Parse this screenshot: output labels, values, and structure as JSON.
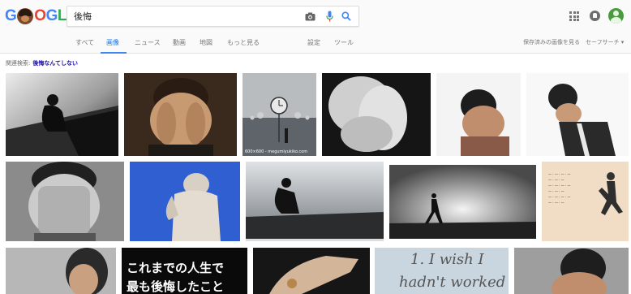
{
  "logo": {
    "letters": [
      "G",
      "O",
      "G",
      "L",
      "E"
    ],
    "colors": [
      "#4285f4",
      "#ea4335",
      "#4285f4",
      "#34a853",
      "#ea4335"
    ]
  },
  "search": {
    "value": "後悔",
    "placeholder": ""
  },
  "tabs": [
    {
      "label": "すべて",
      "active": false
    },
    {
      "label": "画像",
      "active": true
    },
    {
      "label": "ニュース",
      "active": false
    },
    {
      "label": "動画",
      "active": false
    },
    {
      "label": "地図",
      "active": false
    },
    {
      "label": "もっと見る",
      "active": false
    },
    {
      "label": "設定",
      "active": false
    },
    {
      "label": "ツール",
      "active": false
    }
  ],
  "tools_right": {
    "saved_images": "保存済みの画像を見る",
    "safe_search": "セーフサーチ ▾"
  },
  "related": {
    "prefix": "関連検索:",
    "link": "後悔なんてしない"
  },
  "image_results": {
    "row1_caption": "600×600 - megumiyukiko.com",
    "row3_text_line1": "これまでの人生で",
    "row3_text_line2": "最も後悔したこと",
    "row3_hand_line1": "1. I wish I",
    "row3_hand_line2": "hadn't worked so"
  },
  "colors": {
    "accent": "#4285f4",
    "link": "#1a0dab"
  }
}
